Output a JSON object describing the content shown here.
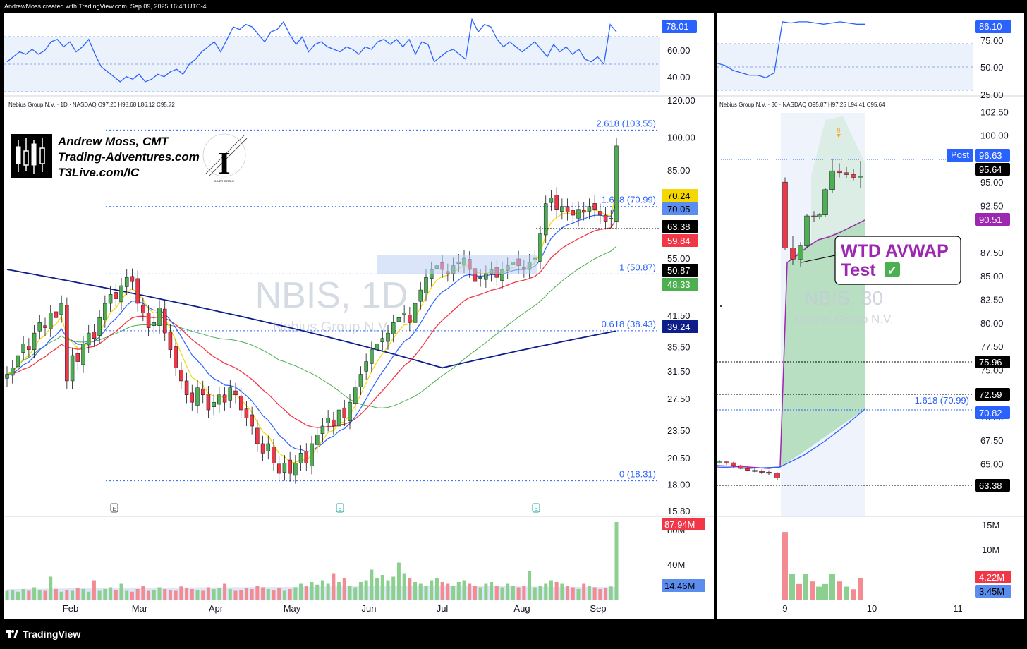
{
  "header": {
    "text": "AndrewMoss created with TradingView.com, Sep 09, 2025 16:48 UTC-4"
  },
  "footer": {
    "brand": "TradingView"
  },
  "colors": {
    "up": "#4caf50",
    "down": "#f23645",
    "ema8": "#f5d800",
    "ema21": "#2962ff",
    "ema50": "#f23645",
    "sma100": "#4caf50",
    "sma200": "#0d1e8a",
    "fib": "#2962ff",
    "avwap": "#9c27b0",
    "rsi": "#2962ff"
  },
  "branding": {
    "line1": "Andrew Moss, CMT",
    "line2": "Trading-Adventures.com",
    "line3": "T3Live.com/IC",
    "seal_text": "INNER CIRCLE"
  },
  "chart_data": [
    {
      "type": "line",
      "panel": "daily-rsi",
      "ylim": [
        30,
        90
      ],
      "tick_labels": [
        "60.00",
        "40.00"
      ],
      "last_label": "78.01",
      "x_labels": [
        "Feb",
        "Mar",
        "Apr",
        "May",
        "Jun",
        "Jul",
        "Aug",
        "Sep"
      ],
      "values": [
        54,
        58,
        62,
        60,
        64,
        60,
        63,
        70,
        72,
        66,
        70,
        62,
        66,
        72,
        60,
        50,
        46,
        42,
        38,
        42,
        40,
        44,
        38,
        40,
        44,
        42,
        46,
        48,
        44,
        52,
        56,
        62,
        66,
        70,
        62,
        72,
        82,
        80,
        84,
        82,
        76,
        70,
        78,
        80,
        86,
        76,
        68,
        74,
        62,
        68,
        70,
        66,
        64,
        62,
        66,
        64,
        60,
        66,
        64,
        70,
        72,
        68,
        72,
        66,
        72,
        60,
        70,
        68,
        54,
        58,
        62,
        64,
        60,
        56,
        88,
        78,
        84,
        82,
        72,
        66,
        70,
        66,
        62,
        66,
        70,
        64,
        58,
        68,
        62,
        66,
        60,
        64,
        56,
        54,
        58,
        52,
        84,
        78
      ]
    },
    {
      "type": "candlestick",
      "panel": "daily-price",
      "title": "Nebius Group N.V. · 1D · NASDAQ",
      "ohlc_text": "O97.20 H98.68 L86.12 C95.72",
      "watermark_ticker": "NBIS, 1D",
      "watermark_name": "Nebius Group N.V.",
      "y_ticks": [
        "120.00",
        "100.00",
        "85.00",
        "70.00",
        "55.00",
        "41.50",
        "35.50",
        "31.50",
        "27.50",
        "23.50",
        "20.50",
        "18.00",
        "15.80"
      ],
      "x_labels": [
        "Feb",
        "Mar",
        "Apr",
        "May",
        "Jun",
        "Jul",
        "Aug",
        "Sep"
      ],
      "fib_levels": [
        {
          "label": "2.618 (103.55)",
          "value": 103.55
        },
        {
          "label": "1.618 (70.99)",
          "value": 70.99
        },
        {
          "label": "1 (50.87)",
          "value": 50.87
        },
        {
          "label": "0.618 (38.43)",
          "value": 38.43
        },
        {
          "label": "0 (18.31)",
          "value": 18.31
        }
      ],
      "price_tags": [
        {
          "text": "70.24",
          "color": "#f5d800",
          "text_color": "#000"
        },
        {
          "text": "70.05",
          "color": "#5b8def",
          "text_color": "#000"
        },
        {
          "text": "63.38",
          "color": "#000000",
          "text_color": "#fff"
        },
        {
          "text": "59.84",
          "color": "#f23645",
          "text_color": "#fff"
        },
        {
          "text": "50.87",
          "color": "#000000",
          "text_color": "#fff"
        },
        {
          "text": "48.33",
          "color": "#4caf50",
          "text_color": "#fff"
        },
        {
          "text": "39.24",
          "color": "#0d1e8a",
          "text_color": "#fff"
        }
      ],
      "events": [
        "E",
        "E",
        "E"
      ],
      "closes": [
        31,
        32,
        34,
        36,
        35,
        38,
        40,
        39,
        42,
        41,
        44,
        30,
        34,
        33,
        36,
        38,
        37,
        41,
        44,
        46,
        45,
        48,
        50,
        49,
        44,
        42,
        39,
        40,
        43,
        38,
        35,
        32,
        30,
        28,
        27,
        29,
        28,
        26,
        27,
        28,
        27,
        29,
        28,
        26,
        25,
        24,
        22,
        21,
        22,
        20,
        19,
        20,
        19,
        20,
        21,
        20,
        22,
        23,
        24,
        25,
        24,
        26,
        25,
        27,
        29,
        31,
        33,
        35,
        36,
        37,
        38,
        40,
        41,
        42,
        40,
        44,
        47,
        50,
        52,
        53,
        52,
        51,
        53,
        54,
        55,
        52,
        49,
        50,
        51,
        52,
        50,
        52,
        53,
        54,
        53,
        52,
        54,
        55,
        62,
        72,
        74,
        70,
        71,
        69,
        68,
        70,
        69,
        71,
        70,
        68,
        66,
        67,
        95.72
      ],
      "volume_label": "87.94M",
      "volume_avg_label": "14.46M",
      "volume_ticks": [
        "80M",
        "40M"
      ],
      "volumes": [
        10,
        11,
        9,
        12,
        10,
        14,
        11,
        10,
        26,
        12,
        9,
        11,
        10,
        13,
        12,
        9,
        22,
        10,
        12,
        14,
        11,
        18,
        10,
        9,
        12,
        16,
        10,
        11,
        14,
        12,
        11,
        10,
        15,
        13,
        12,
        11,
        10,
        14,
        12,
        13,
        18,
        12,
        10,
        11,
        13,
        12,
        16,
        14,
        12,
        11,
        13,
        10,
        12,
        14,
        18,
        16,
        20,
        17,
        22,
        18,
        30,
        20,
        24,
        16,
        14,
        20,
        22,
        34,
        24,
        28,
        22,
        26,
        42,
        30,
        24,
        20,
        18,
        16,
        22,
        24,
        20,
        18,
        16,
        20,
        22,
        18,
        16,
        14,
        18,
        20,
        16,
        14,
        18,
        16,
        14,
        16,
        32,
        14,
        16,
        18,
        22,
        20,
        18,
        16,
        14,
        12,
        18,
        16,
        14,
        12,
        13,
        15,
        88
      ]
    },
    {
      "type": "line",
      "panel": "intraday-rsi",
      "ylim": [
        25,
        90
      ],
      "tick_labels": [
        "75.00",
        "50.00",
        "25.00"
      ],
      "last_label": "86.10",
      "values": [
        52,
        50,
        46,
        44,
        42,
        42,
        40,
        44,
        86,
        85,
        86,
        86,
        85,
        84,
        85,
        86,
        85,
        84,
        84
      ]
    },
    {
      "type": "candlestick",
      "panel": "intraday-price",
      "title": "Nebius Group N.V. · 30 · NASDAQ",
      "ohlc_text": "O95.87 H97.25 L94.41 C95.64",
      "watermark_ticker": "NBIS, 30",
      "watermark_name": "Nebius Group N.V.",
      "y_ticks": [
        "102.50",
        "100.00",
        "95.00",
        "92.50",
        "87.50",
        "85.00",
        "82.50",
        "80.00",
        "77.50",
        "75.00",
        "70.00",
        "67.50",
        "65.00",
        "62.50"
      ],
      "x_labels": [
        "9",
        "10",
        "11"
      ],
      "fib_levels": [
        {
          "label": "1.618 (70.99)",
          "value": 70.99
        }
      ],
      "sequential_label": "9",
      "post_label": "Post",
      "price_tags": [
        {
          "text": "96.63",
          "color": "#2962ff",
          "text_color": "#fff"
        },
        {
          "text": "95.64",
          "color": "#000000",
          "text_color": "#fff"
        },
        {
          "text": "90.51",
          "color": "#9c27b0",
          "text_color": "#fff"
        },
        {
          "text": "75.96",
          "color": "#000000",
          "text_color": "#fff"
        },
        {
          "text": "72.59",
          "color": "#000000",
          "text_color": "#fff"
        },
        {
          "text": "70.82",
          "color": "#2962ff",
          "text_color": "#fff"
        },
        {
          "text": "63.38",
          "color": "#000000",
          "text_color": "#fff"
        }
      ],
      "annotation": {
        "line1": "WTD AVWAP",
        "line2": "Test",
        "check": "✅"
      },
      "volume_label": "4.22M",
      "volume_avg_label": "3.45M",
      "volume_ticks": [
        "15M",
        "10M"
      ]
    }
  ]
}
